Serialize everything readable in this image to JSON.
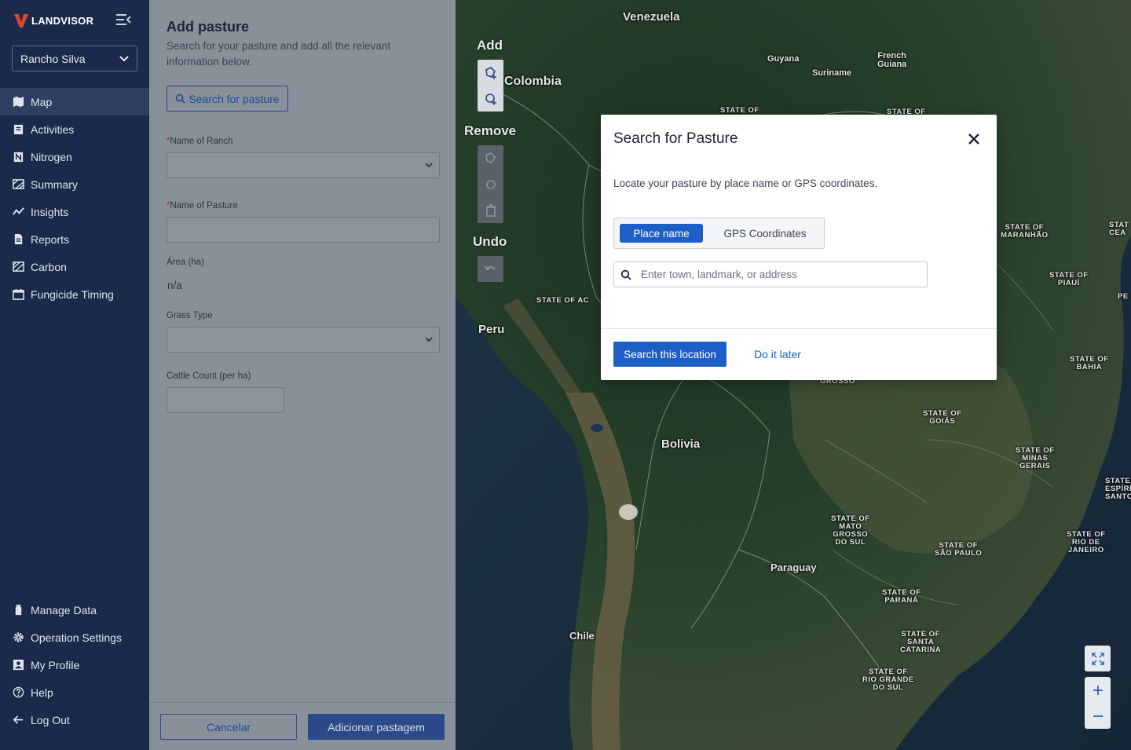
{
  "app": {
    "logo_text": "LANDVISOR",
    "ranch_selector": "Rancho Silva"
  },
  "sidebar": {
    "items": [
      {
        "label": "Map",
        "icon": "map-icon"
      },
      {
        "label": "Activities",
        "icon": "clipboard-icon"
      },
      {
        "label": "Nitrogen",
        "icon": "nitrogen-icon"
      },
      {
        "label": "Summary",
        "icon": "summary-icon"
      },
      {
        "label": "Insights",
        "icon": "chart-line-icon"
      },
      {
        "label": "Reports",
        "icon": "report-icon"
      },
      {
        "label": "Carbon",
        "icon": "carbon-icon"
      },
      {
        "label": "Fungicide Timing",
        "icon": "calendar-icon"
      }
    ],
    "bottom_items": [
      {
        "label": "Manage Data",
        "icon": "data-icon"
      },
      {
        "label": "Operation Settings",
        "icon": "gear-icon"
      },
      {
        "label": "My Profile",
        "icon": "profile-icon"
      },
      {
        "label": "Help",
        "icon": "help-icon"
      },
      {
        "label": "Log Out",
        "icon": "logout-icon"
      }
    ]
  },
  "form": {
    "title": "Add pasture",
    "subtitle": "Search for your pasture and add all the relevant information below.",
    "search_button": "Search for pasture",
    "ranch_label": "Name of Ranch",
    "pasture_label": "Name of Pasture",
    "area_label": "Área (ha)",
    "area_value": "n/a",
    "grass_label": "Grass Type",
    "cattle_label": "Cattle Count (per ha)",
    "required_mark": "*",
    "cancel_button": "Cancelar",
    "submit_button": "Adicionar pastagem"
  },
  "map": {
    "tool_add": "Add",
    "tool_remove": "Remove",
    "tool_undo": "Undo",
    "countries": {
      "venezuela": "Venezuela",
      "colombia": "Colombia",
      "guyana": "Guyana",
      "suriname": "Suriname",
      "french_guiana": "French\nGuiana",
      "peru": "Peru",
      "bolivia": "Bolivia",
      "paraguay": "Paraguay",
      "chile": "Chile"
    },
    "states": {
      "maranhao": "STATE OF\nMARANHÃO",
      "piaui": "STATE OF\nPIAUÍ",
      "bahia": "STATE OF\nBAHIA",
      "goias": "STATE OF\nGOIÁS",
      "minas": "STATE OF\nMINAS\nGERAIS",
      "espirito": "STATE\nESPÍRITO\nSANTO",
      "ms": "STATE OF\nMATO\nGROSSO\nDO SUL",
      "sp": "STATE OF\nSÃO PAULO",
      "rj": "STATE OF\nRIO DE\nJANEIRO",
      "parana": "STATE OF\nPARANÁ",
      "sc": "STATE OF\nSANTA\nCATARINA",
      "rs": "STATE OF\nRIO GRANDE\nDO SUL",
      "acre": "STATE OF AC",
      "grosso": "GROSSO",
      "ceara": "STAT\nCEA",
      "pe": "PE",
      "top1": "STATE OF",
      "top2": "STATE OF"
    }
  },
  "modal": {
    "title": "Search for Pasture",
    "description": "Locate your pasture by place name or GPS coordinates.",
    "tab_place": "Place name",
    "tab_gps": "GPS Coordinates",
    "search_placeholder": "Enter town, landmark, or address",
    "primary_button": "Search this location",
    "secondary_button": "Do it later"
  },
  "colors": {
    "sidebar_bg": "#1b2a4a",
    "accent": "#1e5fc7",
    "logo_red": "#d9462b"
  }
}
